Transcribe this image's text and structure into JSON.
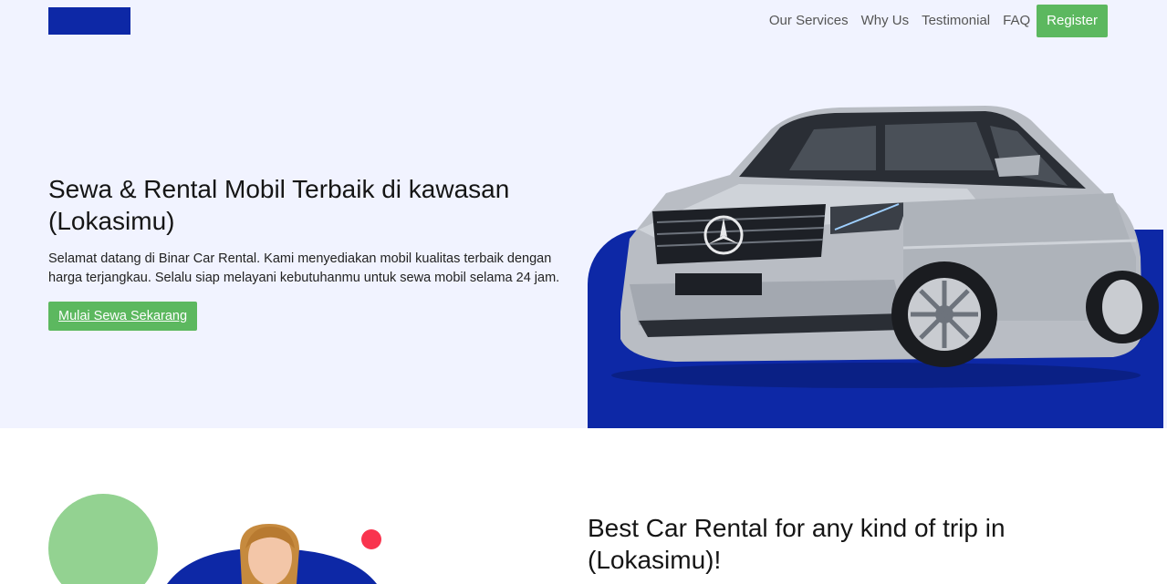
{
  "nav": {
    "links": [
      "Our Services",
      "Why Us",
      "Testimonial",
      "FAQ"
    ],
    "register_label": "Register"
  },
  "hero": {
    "title": "Sewa & Rental Mobil Terbaik di kawasan (Lokasimu)",
    "description": "Selamat datang di Binar Car Rental. Kami menyediakan mobil kualitas terbaik dengan harga terjangkau. Selalu siap melayani kebutuhanmu untuk sewa mobil selama 24 jam.",
    "cta_label": "Mulai Sewa Sekarang",
    "image_icon": "car-image"
  },
  "section2": {
    "title": "Best Car Rental for any kind of trip in (Lokasimu)!",
    "image_icon": "customer-service-agent-image"
  },
  "colors": {
    "brand_blue": "#0d28a6",
    "accent_green": "#5cb85f",
    "hero_bg": "#f1f3ff",
    "circle_green": "#93d291",
    "dot_red": "#f9344e"
  }
}
